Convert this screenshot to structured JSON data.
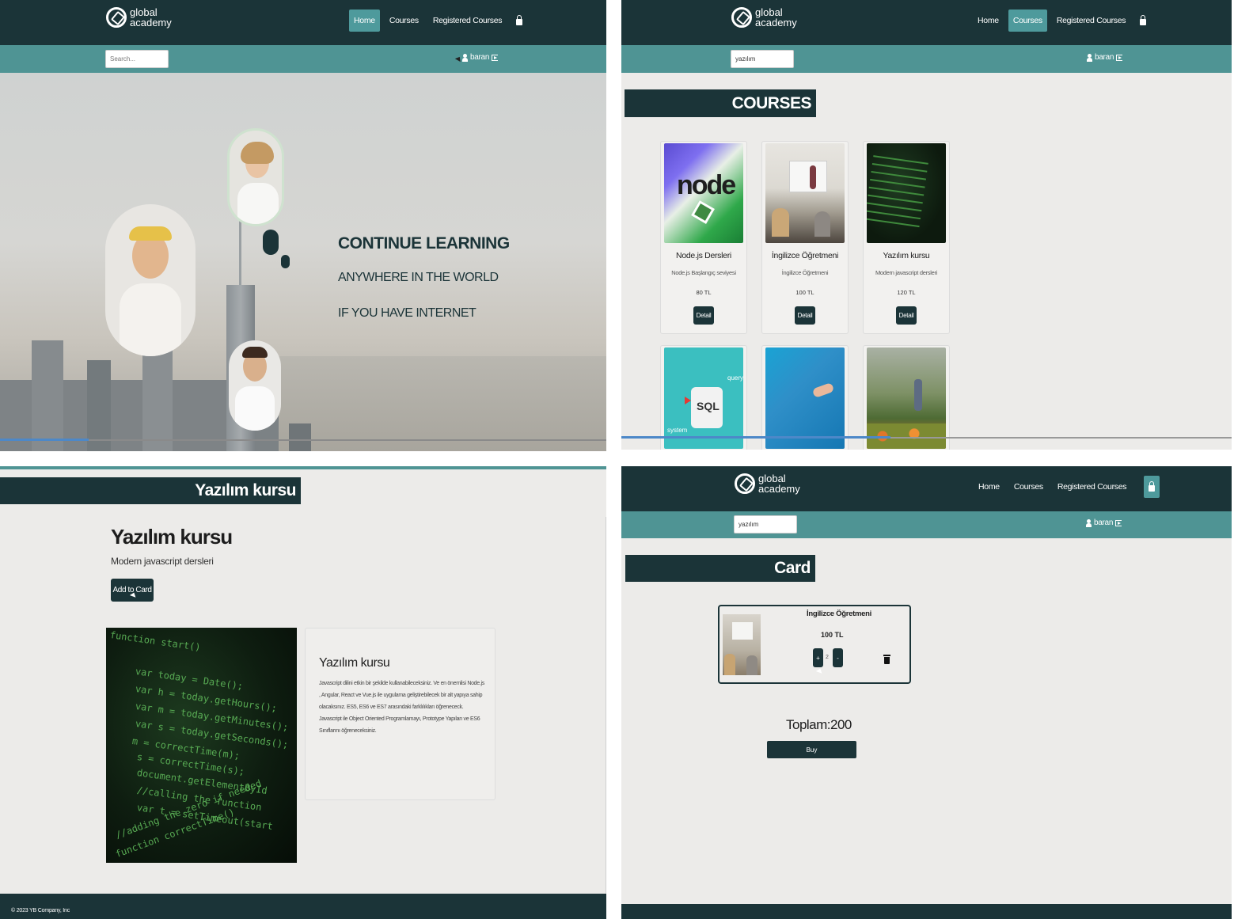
{
  "brand": {
    "line1": "global",
    "line2": "academy"
  },
  "nav": {
    "home": "Home",
    "courses": "Courses",
    "registered": "Registered Courses"
  },
  "user": {
    "name": "baran"
  },
  "q1": {
    "search_placeholder": "Search...",
    "hero_line1": "CONTINUE LEARNING",
    "hero_line2": "ANYWHERE IN THE WORLD",
    "hero_line3": "IF YOU HAVE INTERNET"
  },
  "q2": {
    "search_value": "yazılım",
    "section_title": "COURSES",
    "courses": [
      {
        "title": "Node.js Dersleri",
        "desc": "Node.js Başlangıç seviyesi",
        "price": "80 TL",
        "button": "Detail"
      },
      {
        "title": "İngilizce Öğretmeni",
        "desc": "İngilizce Öğretmeni",
        "price": "100 TL",
        "button": "Detail"
      },
      {
        "title": "Yazılım kursu",
        "desc": "Modern javascript dersleri",
        "price": "120 TL",
        "button": "Detail"
      }
    ],
    "sql_label": "SQL",
    "query_label": "query",
    "system_label": "system"
  },
  "q3": {
    "section_title": "Yazılım kursu",
    "title": "Yazılım kursu",
    "subtitle": "Modern javascript dersleri",
    "add_button": "Add to Card",
    "box_title": "Yazılım kursu",
    "box_text": "Javascript dilini etkin bir şekilde kullanabileceksiniz. Ve en önemlisi Node.js , Angular, React ve Vue.js ile uygulama geliştirebilecek bir alt yapıya sahip olacaksınız. ES5, ES6 ve ES7 arasındaki farklılıkları öğrenececk. Javascript ile Object Oriented Programlamayı, Prototype Yapıları ve ES6 Sınıflarını öğreneceksiniz.",
    "footer": "© 2023 YB Company, Inc",
    "code_lines": [
      "function start()",
      "var today =      Date();",
      "var h = today.getHours();",
      "var m = today.getMinutes();",
      "var s = today.getSeconds();",
      "m = correctTime(m);",
      "s = correctTime(s);",
      "document.getElementById",
      "//calling the function",
      "var t = setTimeout(start",
      "//adding the zero if needed",
      "function correctTime()"
    ]
  },
  "q4": {
    "search_value": "yazılım",
    "section_title": "Card",
    "item_title": "İngilizce Öğretmeni",
    "item_price": "100 TL",
    "plus": "+",
    "minus": "-",
    "qty": "2",
    "total": "Toplam:200",
    "buy": "Buy"
  },
  "colors": {
    "dark": "#1b3438",
    "teal": "#4f9494",
    "bg": "#ecebe9"
  }
}
